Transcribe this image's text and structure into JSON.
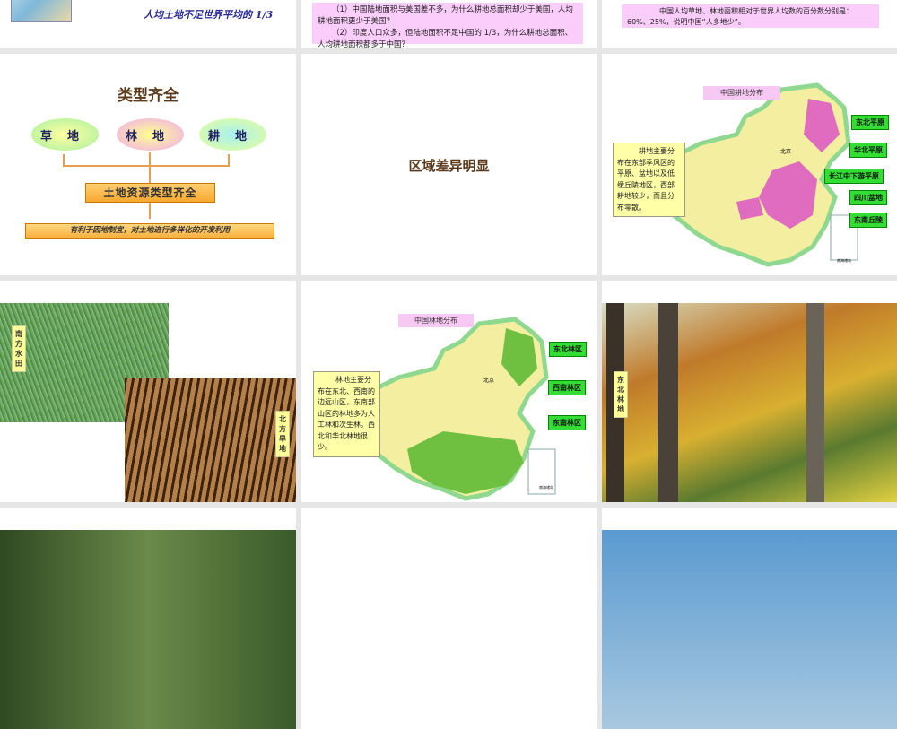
{
  "slides": [
    {
      "caption": "人均土地不足世界平均的 1/3"
    },
    {
      "question1": "（1）中国陆地面积与美国差不多，为什么耕地总面积却少于美国，人均耕地面积更少于美国？",
      "question2": "（2）印度人口众多，但陆地面积不足中国的 1/3，为什么耕地总面积、人均耕地面积都多于中国？"
    },
    {
      "text": "中国人均草地、林地面积相对于世界人均数的百分数分别是：60%、25%，说明中国“人多地少”。"
    },
    {
      "title": "类型齐全",
      "ovals": [
        "草　地",
        "林　地",
        "耕　地"
      ],
      "center_box": "土地资源类型齐全",
      "bottom_box": "有利于因地制宜，对土地进行多样化的开发利用"
    },
    {
      "title": "区域差异明显"
    },
    {
      "map_title": "中国耕地分布",
      "note": "耕地主要分布在东部季风区的平原、盆地以及低缓丘陵地区，西部耕地较少，而且分布零散。",
      "labels": [
        "东北平原",
        "华北平原",
        "长江中下游平原",
        "四川盆地",
        "东南丘陵"
      ],
      "city": "北京",
      "inset": "南海诸岛"
    },
    {
      "label_south": "南方水田",
      "label_north": "北方旱地"
    },
    {
      "map_title": "中国林地分布",
      "note": "林地主要分布在东北、西南的边远山区，东南部山区的林地多为人工林和次生林。西北和华北林地很少。",
      "labels": [
        "东北林区",
        "西南林区",
        "东南林区"
      ],
      "city": "北京",
      "inset": "南海诸岛"
    },
    {
      "label": "东北林地"
    }
  ]
}
